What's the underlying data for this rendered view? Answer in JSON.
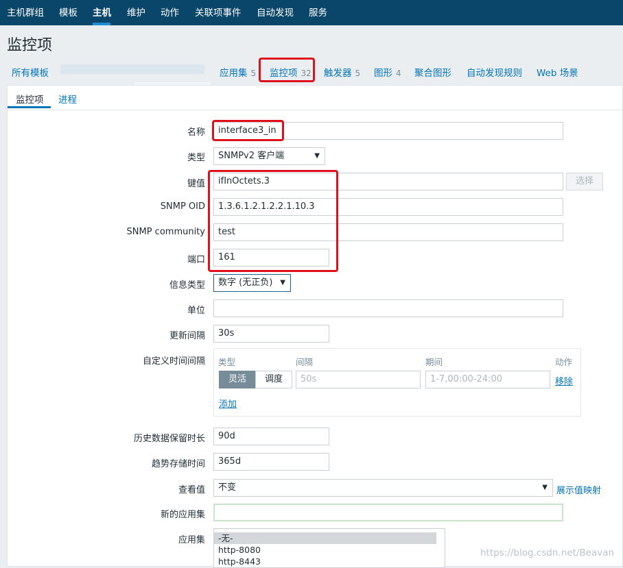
{
  "topnav": {
    "items": [
      "主机群组",
      "模板",
      "主机",
      "维护",
      "动作",
      "关联项事件",
      "自动发现",
      "服务"
    ],
    "active": "主机"
  },
  "page_title": "监控项",
  "crumbs": {
    "all_templates": "所有模板",
    "apps": "应用集",
    "apps_count": "5",
    "items": "监控项",
    "items_count": "32",
    "triggers": "触发器",
    "triggers_count": "5",
    "graphs": "图形",
    "graphs_count": "4",
    "screens": "聚合图形",
    "discovery": "自动发现规则",
    "web": "Web 场景"
  },
  "subtabs": {
    "items": "监控项",
    "process": "进程"
  },
  "form": {
    "name_label": "名称",
    "name_value": "interface3_in",
    "type_label": "类型",
    "type_value": "SNMPv2 客户端",
    "key_label": "键值",
    "key_value": "ifInOctets.3",
    "select_button": "选择",
    "oid_label": "SNMP OID",
    "oid_value": "1.3.6.1.2.1.2.2.1.10.3",
    "community_label": "SNMP community",
    "community_value": "test",
    "port_label": "端口",
    "port_value": "161",
    "info_type_label": "信息类型",
    "info_type_value": "数字 (无正负)",
    "units_label": "单位",
    "units_value": "",
    "interval_label": "更新间隔",
    "interval_value": "30s",
    "custom_label": "自定义时间间隔",
    "custom": {
      "col_type": "类型",
      "col_interval": "间隔",
      "col_period": "期间",
      "col_action": "动作",
      "flexible": "灵活",
      "scheduling": "调度",
      "interval_placeholder": "50s",
      "period_placeholder": "1-7,00:00-24:00",
      "remove": "移除",
      "add": "添加"
    },
    "history_label": "历史数据保留时长",
    "history_value": "90d",
    "trends_label": "趋势存储时间",
    "trends_value": "365d",
    "show_value_label": "查看值",
    "show_value_value": "不变",
    "show_value_link": "展示值映射",
    "new_app_label": "新的应用集",
    "new_app_value": "",
    "apps_label": "应用集",
    "apps_options": [
      "-无-",
      "http-8080",
      "http-8443"
    ]
  },
  "watermark": "https://blog.csdn.net/Beavan",
  "colors": {
    "topbar": "#0a466a",
    "link": "#0275b8",
    "highlight": "#e0101a"
  }
}
